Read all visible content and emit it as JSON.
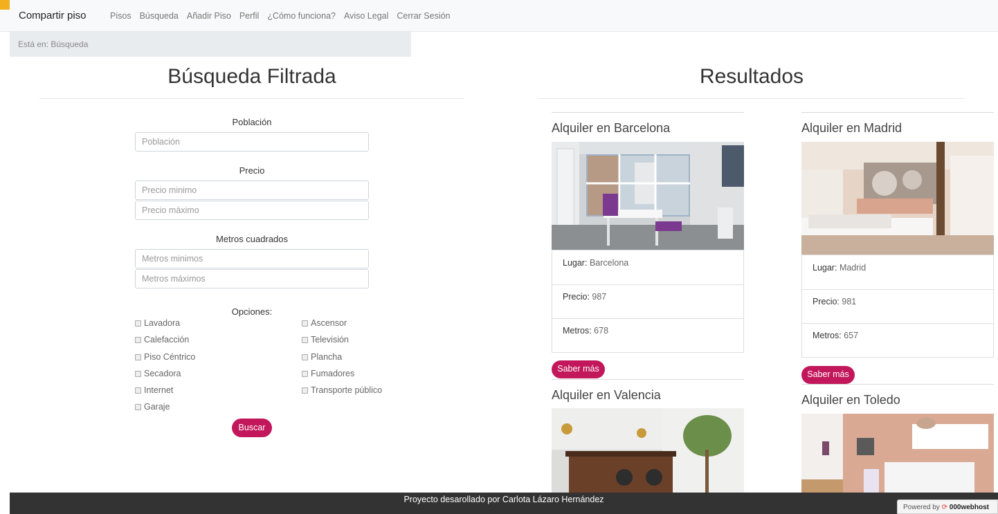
{
  "nav": {
    "brand": "Compartir piso",
    "links": [
      "Pisos",
      "Búsqueda",
      "Añadir Piso",
      "Perfil",
      "¿Cómo funciona?",
      "Aviso Legal",
      "Cerrar Sesión"
    ]
  },
  "breadcrumb": "Está en: Búsqueda",
  "search": {
    "title": "Búsqueda Filtrada",
    "poblacion_label": "Población",
    "poblacion_placeholder": "Población",
    "precio_label": "Precio",
    "precio_min_placeholder": "Precio minimo",
    "precio_max_placeholder": "Precio máximo",
    "metros_label": "Metros cuadrados",
    "metros_min_placeholder": "Metros minimos",
    "metros_max_placeholder": "Metros máximos",
    "opciones_label": "Opciones:",
    "options_col1": [
      "Lavadora",
      "Calefacción",
      "Piso Céntrico",
      "Secadora",
      "Internet",
      "Garaje"
    ],
    "options_col2": [
      "Ascensor",
      "Televisión",
      "Plancha",
      "Fumadores",
      "Transporte público"
    ],
    "submit": "Buscar"
  },
  "results": {
    "title": "Resultados",
    "cards": [
      {
        "title": "Alquiler en Barcelona",
        "lugar_label": "Lugar:",
        "lugar": "Barcelona",
        "precio_label": "Precio:",
        "precio": "987",
        "metros_label": "Metros:",
        "metros": "678",
        "button": "Saber más"
      },
      {
        "title": "Alquiler en Madrid",
        "lugar_label": "Lugar:",
        "lugar": "Madrid",
        "precio_label": "Precio:",
        "precio": "981",
        "metros_label": "Metros:",
        "metros": "657",
        "button": "Saber más"
      },
      {
        "title": "Alquiler en Valencia"
      },
      {
        "title": "Alquiler en Toledo"
      }
    ]
  },
  "footer": {
    "text": "Proyecto desarollado por Carlota Lázaro Hernández",
    "powered_prefix": "Powered by",
    "powered_brand": "000webhost"
  },
  "colors": {
    "accent": "#c2185b",
    "footer_bg": "#333333",
    "navbar_bg": "#f8f9fa"
  }
}
